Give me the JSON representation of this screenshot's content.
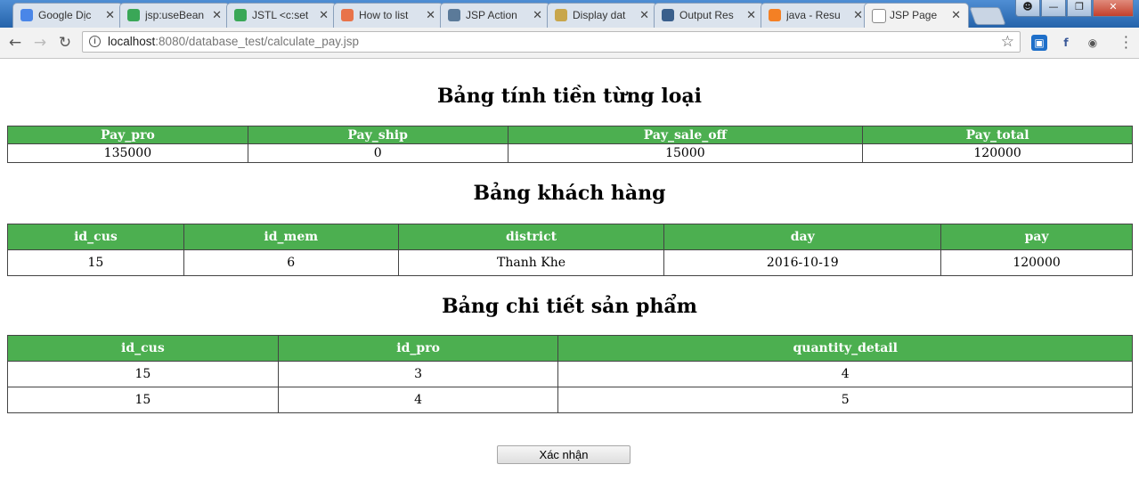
{
  "browser": {
    "tabs": [
      {
        "title": "Google Dịc",
        "favicon_color": "#4a86e8",
        "favicon": "google-translate-icon"
      },
      {
        "title": "jsp:useBean",
        "favicon_color": "#3aa757",
        "favicon": "b-icon"
      },
      {
        "title": "JSTL <c:set",
        "favicon_color": "#3aa757",
        "favicon": "b-icon"
      },
      {
        "title": "How to list",
        "favicon_color": "#e8734a",
        "favicon": "j-icon"
      },
      {
        "title": "JSP Action",
        "favicon_color": "#5b7a99",
        "favicon": "diamond-icon"
      },
      {
        "title": "Display dat",
        "favicon_color": "#c8a64b",
        "favicon": "horseshoe-icon"
      },
      {
        "title": "Output Res",
        "favicon_color": "#3a5f8c",
        "favicon": "table-icon"
      },
      {
        "title": "java - Resu",
        "favicon_color": "#f48024",
        "favicon": "stackoverflow-icon"
      },
      {
        "title": "JSP Page",
        "favicon_color": "#ffffff",
        "favicon": "page-icon"
      }
    ],
    "url_host": "localhost",
    "url_path": ":8080/database_test/calculate_pay.jsp"
  },
  "tables": {
    "pay": {
      "heading": "Bảng tính tiền từng loại",
      "headers": [
        "Pay_pro",
        "Pay_ship",
        "Pay_sale_off",
        "Pay_total"
      ],
      "rows": [
        [
          "135000",
          "0",
          "15000",
          "120000"
        ]
      ]
    },
    "customer": {
      "heading": "Bảng khách hàng",
      "headers": [
        "id_cus",
        "id_mem",
        "district",
        "day",
        "pay"
      ],
      "rows": [
        [
          "15",
          "6",
          "Thanh Khe",
          "2016-10-19",
          "120000"
        ]
      ]
    },
    "product_detail": {
      "heading": "Bảng chi tiết sản phẩm",
      "headers": [
        "id_cus",
        "id_pro",
        "quantity_detail"
      ],
      "rows": [
        [
          "15",
          "3",
          "4"
        ],
        [
          "15",
          "4",
          "5"
        ]
      ]
    }
  },
  "confirm_label": "Xác nhận"
}
